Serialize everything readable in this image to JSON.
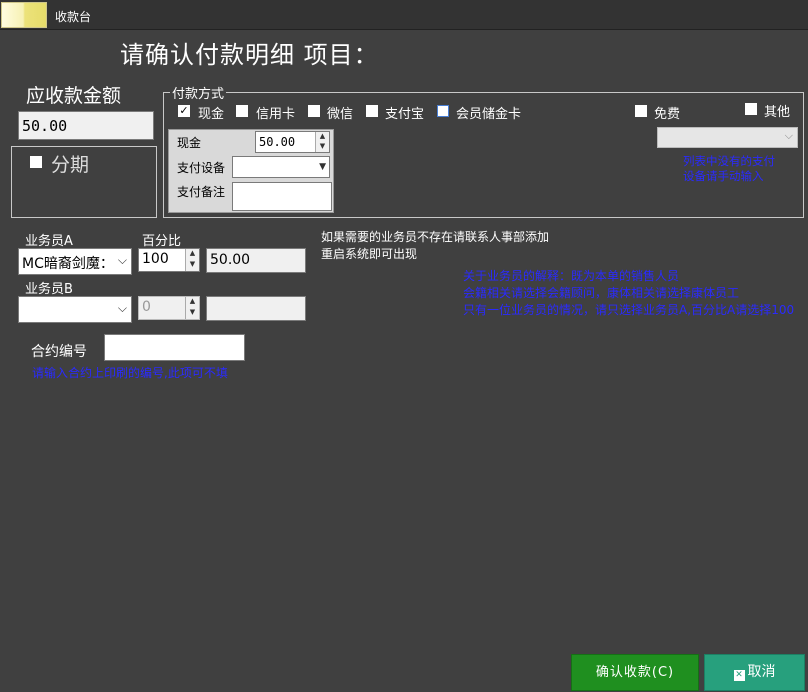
{
  "window": {
    "title": "收款台"
  },
  "heading": "请确认付款明细 项目：",
  "amount_due": {
    "label": "应收款金额",
    "value": "50.00"
  },
  "installment": {
    "label": "分期",
    "checked": false
  },
  "payment": {
    "legend": "付款方式",
    "methods": [
      {
        "label": "现金",
        "checked": true
      },
      {
        "label": "信用卡",
        "checked": false
      },
      {
        "label": "微信",
        "checked": false
      },
      {
        "label": "支付宝",
        "checked": false
      },
      {
        "label": "会员储金卡",
        "checked": false
      }
    ],
    "free": {
      "label": "免费",
      "checked": false
    },
    "other": {
      "label": "其他",
      "checked": false
    },
    "other_select_value": "",
    "other_note": "列表中没有的支付设备请手动输入",
    "cash_label": "现金",
    "cash_value": "50.00",
    "device_label": "支付设备",
    "device_value": "",
    "remark_label": "支付备注",
    "remark_value": ""
  },
  "salesperson_a": {
    "label": "业务员A",
    "value": "MC暗裔剑魔：",
    "percent_label": "百分比",
    "percent": "100",
    "amount": "50.00"
  },
  "salesperson_b": {
    "label": "业务员B",
    "value": "",
    "percent": "0",
    "amount": ""
  },
  "info_text": [
    "如果需要的业务员不存在请联系人事部添加",
    "重启系统即可出现"
  ],
  "explanation": [
    "关于业务员的解释：既为本单的销售人员",
    "会籍相关请选择会籍顾问，康体相关请选择康体员工",
    "只有一位业务员的情况，请只选择业务员A,百分比A请选择100"
  ],
  "contract": {
    "label": "合约编号",
    "value": "",
    "note": "请输入合约上印刷的编号,此项可不填"
  },
  "buttons": {
    "confirm": "确认收款(C)",
    "cancel": "取消"
  }
}
